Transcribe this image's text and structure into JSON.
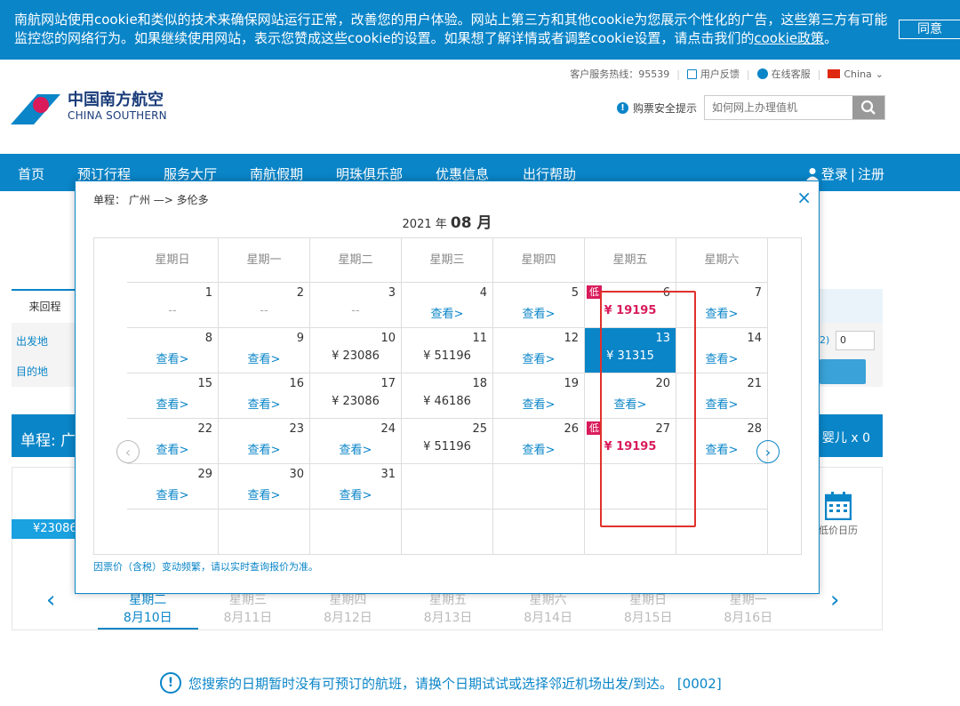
{
  "cookie": {
    "text": "南航网站使用cookie和类似的技术来确保网站运行正常，改善您的用户体验。网站上第三方和其他cookie为您展示个性化的广告，这些第三方有可能监控您的网络行为。如果继续使用网站，表示您赞成这些cookie的设置。如果想了解详情或者调整cookie设置，请点击我们的",
    "link": "cookie政策",
    "end": "。",
    "agree": "同意"
  },
  "header": {
    "hotline": "客户服务热线：95539",
    "feedback": "用户反馈",
    "online_service": "在线客服",
    "region": "China",
    "logo_cn": "中国南方航空",
    "logo_en": "CHINA SOUTHERN",
    "safety_tip": "购票安全提示",
    "search_placeholder": "如何网上办理值机"
  },
  "nav": {
    "items": [
      "首页",
      "预订行程",
      "服务大厅",
      "南航假期",
      "明珠俱乐部",
      "优惠信息",
      "出行帮助"
    ],
    "login": "登录",
    "divider": "|",
    "register": "注册"
  },
  "background": {
    "tab_return": "来回程",
    "from_label": "出发地",
    "to_label": "目的地",
    "select_value": "0",
    "sel_prefix": "2)",
    "trip_label": "单程:",
    "trip_city": "广",
    "infant": "婴儿 x 0",
    "price_tag": "¥23086",
    "low_cal": "低价日历",
    "dates": [
      {
        "week": "星期二",
        "date": "8月10日"
      },
      {
        "week": "星期三",
        "date": "8月11日"
      },
      {
        "week": "星期四",
        "date": "8月12日"
      },
      {
        "week": "星期五",
        "date": "8月13日"
      },
      {
        "week": "星期六",
        "date": "8月14日"
      },
      {
        "week": "星期日",
        "date": "8月15日"
      },
      {
        "week": "星期一",
        "date": "8月16日"
      }
    ],
    "notice": "您搜索的日期暂时没有可预订的航班，请换个日期试试或选择邻近机场出发/到达。 [0002]"
  },
  "modal": {
    "route_label": "单程：",
    "from": "广州",
    "arrow": "—>",
    "to": "多伦多",
    "year": "2021 年",
    "month": "08 月",
    "weekdays": [
      "星期日",
      "星期一",
      "星期二",
      "星期三",
      "星期四",
      "星期五",
      "星期六"
    ],
    "cells": [
      {
        "d": "1",
        "v": "--",
        "t": "dash"
      },
      {
        "d": "2",
        "v": "--",
        "t": "dash"
      },
      {
        "d": "3",
        "v": "--",
        "t": "dash"
      },
      {
        "d": "4",
        "v": "查看>",
        "t": "view"
      },
      {
        "d": "5",
        "v": "查看>",
        "t": "view"
      },
      {
        "d": "6",
        "v": "¥ 19195",
        "t": "low",
        "badge": "低"
      },
      {
        "d": "7",
        "v": "查看>",
        "t": "view"
      },
      {
        "d": "8",
        "v": "查看>",
        "t": "view"
      },
      {
        "d": "9",
        "v": "查看>",
        "t": "view"
      },
      {
        "d": "10",
        "v": "¥ 23086",
        "t": "price"
      },
      {
        "d": "11",
        "v": "¥ 51196",
        "t": "price"
      },
      {
        "d": "12",
        "v": "查看>",
        "t": "view"
      },
      {
        "d": "13",
        "v": "¥ 31315",
        "t": "sel"
      },
      {
        "d": "14",
        "v": "查看>",
        "t": "view"
      },
      {
        "d": "15",
        "v": "查看>",
        "t": "view"
      },
      {
        "d": "16",
        "v": "查看>",
        "t": "view"
      },
      {
        "d": "17",
        "v": "¥ 23086",
        "t": "price"
      },
      {
        "d": "18",
        "v": "¥ 46186",
        "t": "price"
      },
      {
        "d": "19",
        "v": "查看>",
        "t": "view"
      },
      {
        "d": "20",
        "v": "查看>",
        "t": "view"
      },
      {
        "d": "21",
        "v": "查看>",
        "t": "view"
      },
      {
        "d": "22",
        "v": "查看>",
        "t": "view"
      },
      {
        "d": "23",
        "v": "查看>",
        "t": "view"
      },
      {
        "d": "24",
        "v": "查看>",
        "t": "view"
      },
      {
        "d": "25",
        "v": "¥ 51196",
        "t": "price"
      },
      {
        "d": "26",
        "v": "查看>",
        "t": "view"
      },
      {
        "d": "27",
        "v": "¥ 19195",
        "t": "low",
        "badge": "低"
      },
      {
        "d": "28",
        "v": "查看>",
        "t": "view"
      },
      {
        "d": "29",
        "v": "查看>",
        "t": "view"
      },
      {
        "d": "30",
        "v": "查看>",
        "t": "view"
      },
      {
        "d": "31",
        "v": "查看>",
        "t": "view"
      }
    ],
    "note": "因票价（含税）变动频繁，请以实时查询报价为准。",
    "close_symbol": "×"
  },
  "colors": {
    "brand": "#0a85c8",
    "low_price": "#d91b5b",
    "highlight_frame": "#e0312a"
  }
}
